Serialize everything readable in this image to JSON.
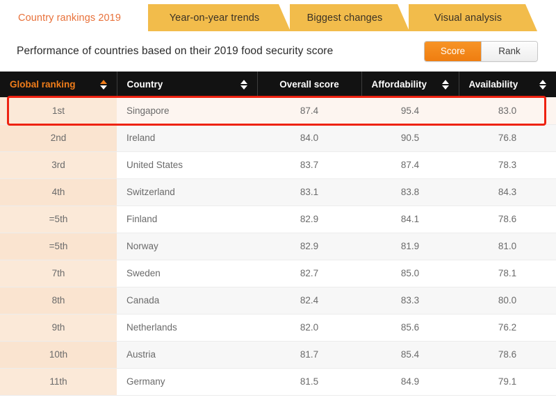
{
  "tabs": [
    {
      "label": "Country rankings 2019",
      "active": true
    },
    {
      "label": "Year-on-year trends",
      "active": false
    },
    {
      "label": "Biggest changes",
      "active": false
    },
    {
      "label": "Visual analysis",
      "active": false
    }
  ],
  "header": {
    "title": "Performance of countries based on their 2019 food security score",
    "toggle": {
      "options": [
        "Score",
        "Rank"
      ],
      "selected": "Score"
    }
  },
  "table": {
    "columns": [
      {
        "label": "Global ranking",
        "sortable": true,
        "sorted": true,
        "sort_direction": "asc",
        "align": "center"
      },
      {
        "label": "Country",
        "sortable": true,
        "sorted": false,
        "align": "left"
      },
      {
        "label": "Overall score",
        "sortable": false,
        "sorted": false,
        "align": "center"
      },
      {
        "label": "Affordability",
        "sortable": true,
        "sorted": false,
        "align": "center"
      },
      {
        "label": "Availability",
        "sortable": true,
        "sorted": false,
        "align": "center"
      }
    ],
    "rows": [
      {
        "rank": "1st",
        "country": "Singapore",
        "overall": "87.4",
        "affordability": "95.4",
        "availability": "83.0",
        "highlighted": true
      },
      {
        "rank": "2nd",
        "country": "Ireland",
        "overall": "84.0",
        "affordability": "90.5",
        "availability": "76.8",
        "highlighted": false
      },
      {
        "rank": "3rd",
        "country": "United States",
        "overall": "83.7",
        "affordability": "87.4",
        "availability": "78.3",
        "highlighted": false
      },
      {
        "rank": "4th",
        "country": "Switzerland",
        "overall": "83.1",
        "affordability": "83.8",
        "availability": "84.3",
        "highlighted": false
      },
      {
        "rank": "=5th",
        "country": "Finland",
        "overall": "82.9",
        "affordability": "84.1",
        "availability": "78.6",
        "highlighted": false
      },
      {
        "rank": "=5th",
        "country": "Norway",
        "overall": "82.9",
        "affordability": "81.9",
        "availability": "81.0",
        "highlighted": false
      },
      {
        "rank": "7th",
        "country": "Sweden",
        "overall": "82.7",
        "affordability": "85.0",
        "availability": "78.1",
        "highlighted": false
      },
      {
        "rank": "8th",
        "country": "Canada",
        "overall": "82.4",
        "affordability": "83.3",
        "availability": "80.0",
        "highlighted": false
      },
      {
        "rank": "9th",
        "country": "Netherlands",
        "overall": "82.0",
        "affordability": "85.6",
        "availability": "76.2",
        "highlighted": false
      },
      {
        "rank": "10th",
        "country": "Austria",
        "overall": "81.7",
        "affordability": "85.4",
        "availability": "78.6",
        "highlighted": false
      },
      {
        "rank": "11th",
        "country": "Germany",
        "overall": "81.5",
        "affordability": "84.9",
        "availability": "79.1",
        "highlighted": false
      }
    ]
  },
  "colors": {
    "tab_inactive": "#f2bc4b",
    "tab_active_text": "#e8713a",
    "accent_orange": "#f07d1a",
    "header_bar": "#121212",
    "rank_column": "#fbe9d8",
    "highlight_border": "#ee2211"
  }
}
